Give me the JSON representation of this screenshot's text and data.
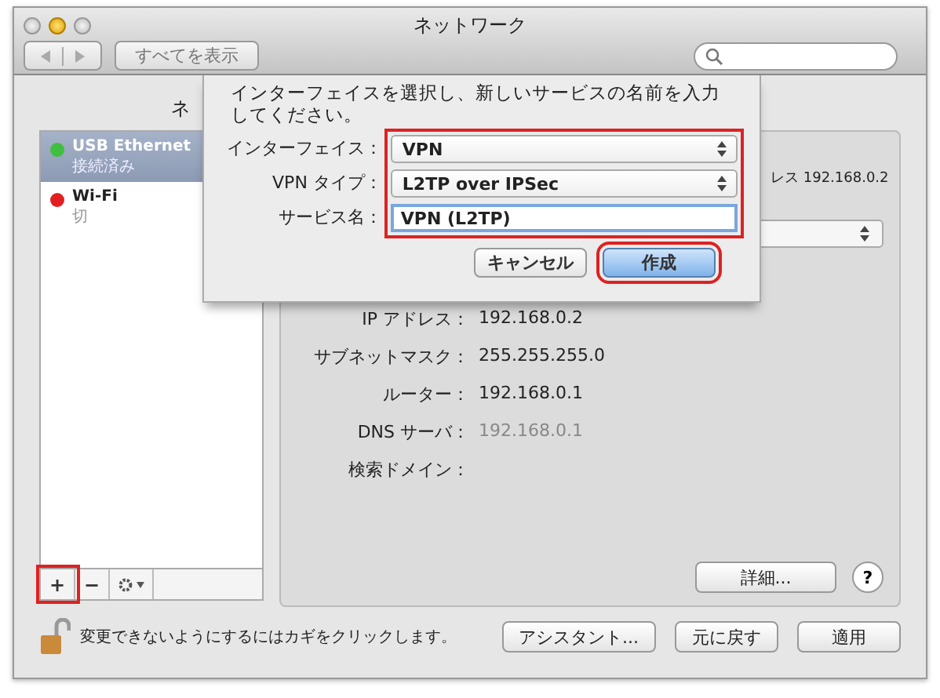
{
  "window": {
    "title": "ネットワーク"
  },
  "toolbar": {
    "show_all": "すべてを表示"
  },
  "location_label": "ネ",
  "services": [
    {
      "name": "USB Ethernet",
      "status": "接続済み",
      "color": "#3fbf3f",
      "selected": true
    },
    {
      "name": "Wi-Fi",
      "status": "切",
      "color": "#e02020",
      "selected": false
    }
  ],
  "service_toolbar": {
    "add": "+",
    "remove": "−",
    "add_highlighted": true
  },
  "panel": {
    "status_text": "レス 192.168.0.2",
    "rows": [
      {
        "label": "IP アドレス：",
        "value": "192.168.0.2"
      },
      {
        "label": "サブネットマスク：",
        "value": "255.255.255.0"
      },
      {
        "label": "ルーター：",
        "value": "192.168.0.1"
      },
      {
        "label": "DNS サーバ：",
        "value": "192.168.0.1",
        "dimmed": true
      },
      {
        "label": "検索ドメイン："
      }
    ],
    "advanced": "詳細...",
    "help": "?"
  },
  "bottom": {
    "lock_text": "変更できないようにするにはカギをクリックします。",
    "buttons": [
      "アシスタント...",
      "元に戻す",
      "適用"
    ]
  },
  "sheet": {
    "message": "インターフェイスを選択し、新しいサービスの名前を入力してください。",
    "fields_highlighted": true,
    "fields": [
      {
        "kind": "popup",
        "label": "インターフェイス：",
        "value": "VPN"
      },
      {
        "kind": "popup",
        "label": "VPN タイプ：",
        "value": "L2TP over IPSec"
      },
      {
        "kind": "text",
        "label": "サービス名：",
        "value": "VPN (L2TP)"
      }
    ],
    "buttons": [
      {
        "label": "キャンセル",
        "default": false,
        "highlighted": false
      },
      {
        "label": "作成",
        "default": true,
        "highlighted": true
      }
    ]
  }
}
